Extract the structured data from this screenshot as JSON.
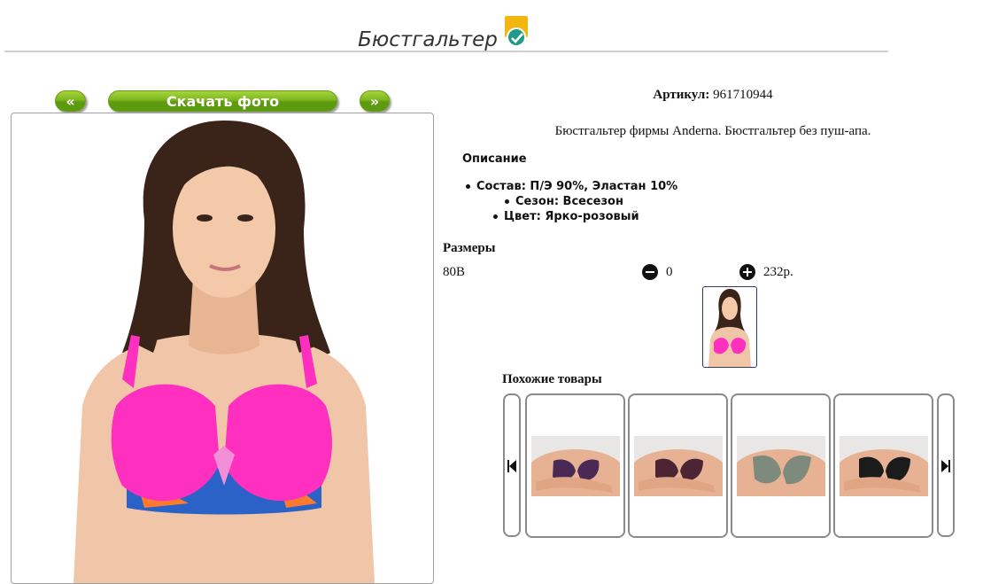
{
  "page": {
    "title": "Бюстгальтер",
    "badge_icon": "verified-check-icon",
    "colors": {
      "accent_green": "#7eb51f",
      "badge_yellow": "#f2b60f",
      "badge_teal": "#1e9a86",
      "product_pink": "#ff2fc0"
    }
  },
  "gallery": {
    "prev_label": "«",
    "download_label": "Скачать фото",
    "next_label": "»"
  },
  "product": {
    "article_label": "Артикул:",
    "article_value": "961710944",
    "description": "Бюстгальтер фирмы Anderna. Бюстгальтер без пуш-апа.",
    "description_heading": "Описание",
    "features": [
      "Состав: П/Э 90%, Эластан 10%",
      "Сезон: Всесезон",
      "Цвет: Ярко-розовый"
    ]
  },
  "sizes": {
    "heading": "Размеры",
    "rows": [
      {
        "size": "80B",
        "quantity": "0",
        "price": "232р."
      }
    ]
  },
  "similar": {
    "heading": "Похожие товары",
    "items": [
      {
        "color": "#4a2a55",
        "icon": "product-photo"
      },
      {
        "color": "#4c2434",
        "icon": "product-photo"
      },
      {
        "color": "#7d8a7c",
        "icon": "product-photo"
      },
      {
        "color": "#1b1b1b",
        "icon": "product-photo"
      }
    ]
  }
}
